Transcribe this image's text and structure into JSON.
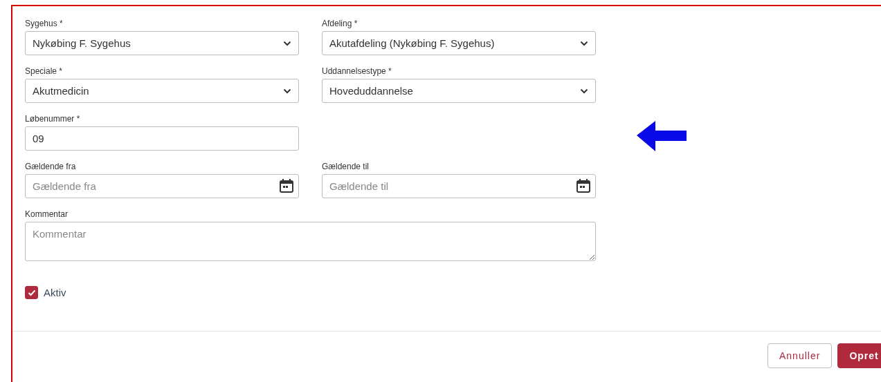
{
  "rows": [
    [
      {
        "label": "Sygehus *",
        "kind": "select",
        "value": "Nykøbing F. Sygehus"
      },
      {
        "label": "Afdeling *",
        "kind": "select",
        "value": "Akutafdeling (Nykøbing F. Sygehus)"
      }
    ],
    [
      {
        "label": "Speciale *",
        "kind": "select",
        "value": "Akutmedicin"
      },
      {
        "label": "Uddannelsestype *",
        "kind": "select",
        "value": "Hoveduddannelse"
      }
    ],
    [
      {
        "label": "Løbenummer *",
        "kind": "text",
        "value": "09"
      }
    ],
    [
      {
        "label": "Gældende fra",
        "kind": "date",
        "placeholder": "Gældende fra"
      },
      {
        "label": "Gældende til",
        "kind": "date",
        "placeholder": "Gældende til"
      }
    ],
    [
      {
        "label": "Kommentar",
        "kind": "textarea",
        "placeholder": "Kommentar"
      }
    ]
  ],
  "active": {
    "label": "Aktiv",
    "checked": true
  },
  "buttons": [
    {
      "label": "Annuller",
      "kind": "secondary"
    },
    {
      "label": "Opret",
      "kind": "primary"
    }
  ]
}
